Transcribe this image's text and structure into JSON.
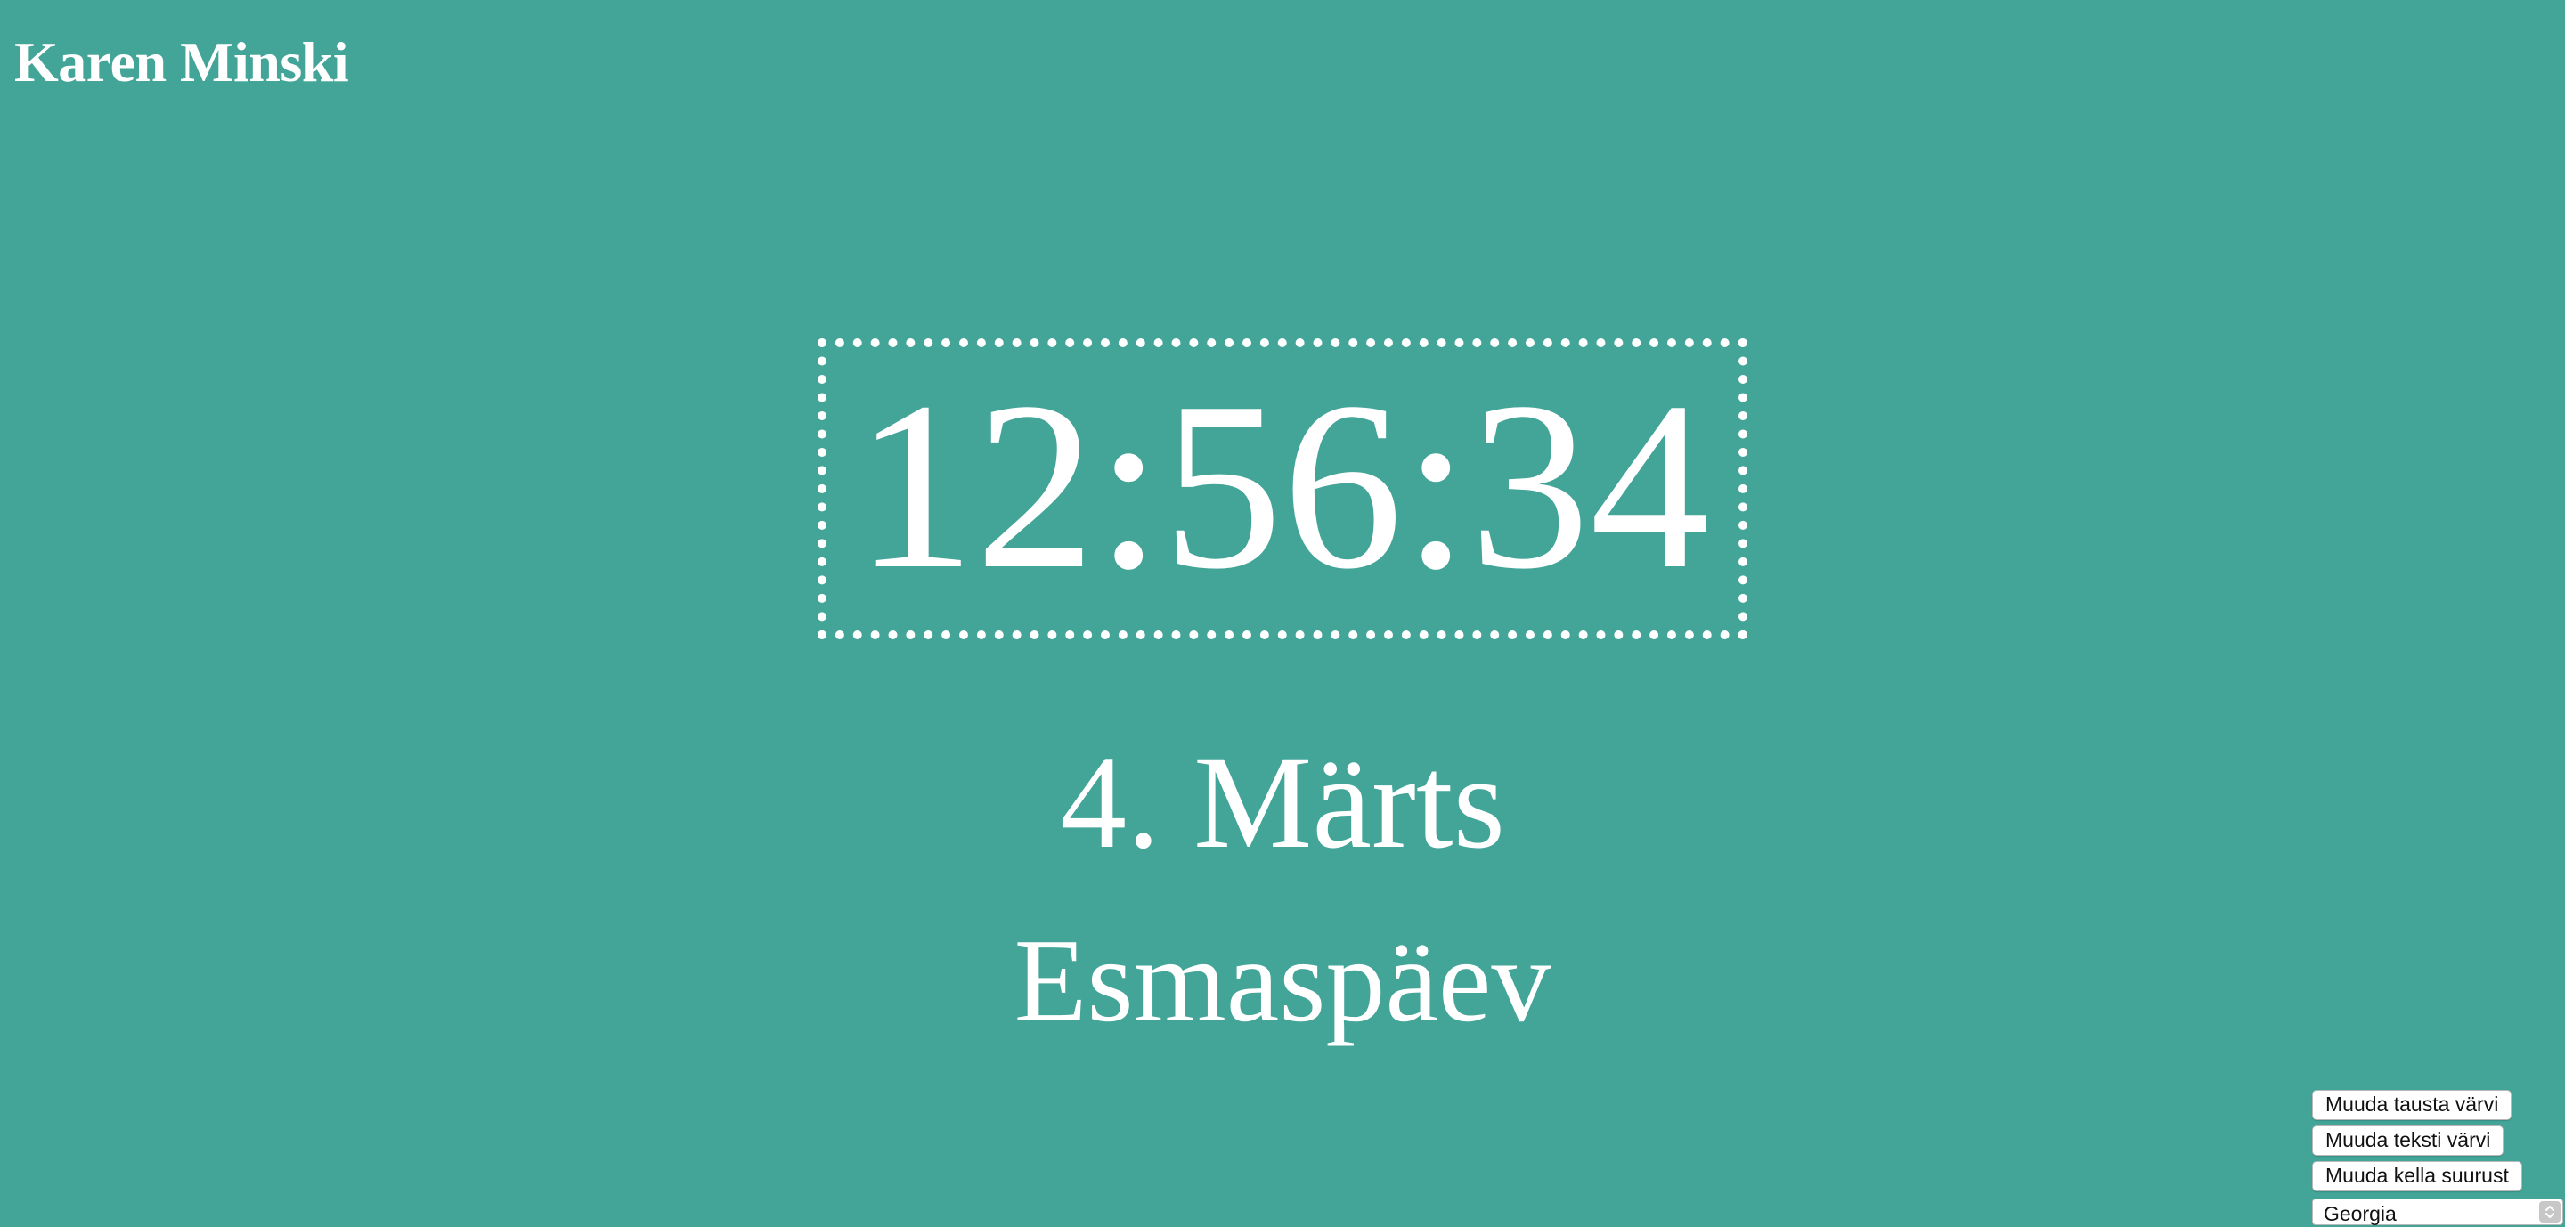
{
  "author": {
    "name": "Karen Minski"
  },
  "clock": {
    "time": "12:56:34",
    "date": "4. Märts",
    "weekday": "Esmaspäev"
  },
  "controls": {
    "change_background_label": "Muuda tausta värvi",
    "change_text_color_label": "Muuda teksti värvi",
    "change_clock_size_label": "Muuda kella suurust",
    "font_select": {
      "selected": "Georgia",
      "icon": "chevron-up-down-icon"
    }
  },
  "colors": {
    "background": "#42a598",
    "text": "#ffffff"
  }
}
